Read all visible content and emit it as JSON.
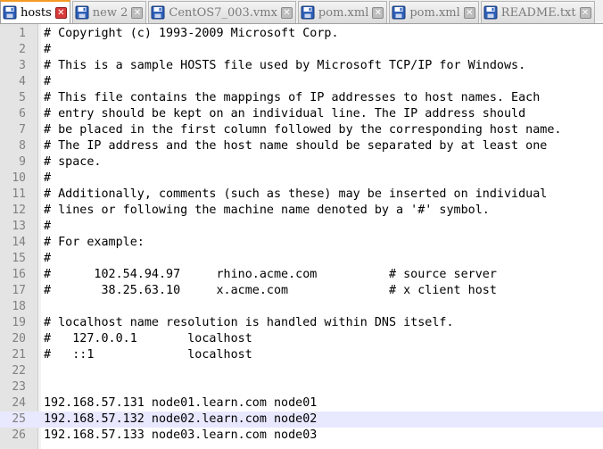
{
  "tabs": [
    {
      "label": "hosts",
      "active": true,
      "icon": "save-icon-blue",
      "close": "✕"
    },
    {
      "label": "new 2",
      "active": false,
      "icon": "save-icon-blue",
      "close": "✕"
    },
    {
      "label": "CentOS7_003.vmx",
      "active": false,
      "icon": "save-icon-blue",
      "close": "✕"
    },
    {
      "label": "pom.xml",
      "active": false,
      "icon": "save-icon-blue",
      "close": "✕"
    },
    {
      "label": "pom.xml",
      "active": false,
      "icon": "save-icon-blue",
      "close": "✕"
    },
    {
      "label": "README.txt",
      "active": false,
      "icon": "save-icon-blue",
      "close": "✕"
    }
  ],
  "colors": {
    "active_tab_accent": "#f59a23",
    "current_line": "#e8e8ff",
    "gutter": "#e4e4e4"
  },
  "current_line": 25,
  "lines": [
    {
      "n": "1",
      "text": "# Copyright (c) 1993-2009 Microsoft Corp."
    },
    {
      "n": "2",
      "text": "#"
    },
    {
      "n": "3",
      "text": "# This is a sample HOSTS file used by Microsoft TCP/IP for Windows."
    },
    {
      "n": "4",
      "text": "#"
    },
    {
      "n": "5",
      "text": "# This file contains the mappings of IP addresses to host names. Each"
    },
    {
      "n": "6",
      "text": "# entry should be kept on an individual line. The IP address should"
    },
    {
      "n": "7",
      "text": "# be placed in the first column followed by the corresponding host name."
    },
    {
      "n": "8",
      "text": "# The IP address and the host name should be separated by at least one"
    },
    {
      "n": "9",
      "text": "# space."
    },
    {
      "n": "10",
      "text": "#"
    },
    {
      "n": "11",
      "text": "# Additionally, comments (such as these) may be inserted on individual"
    },
    {
      "n": "12",
      "text": "# lines or following the machine name denoted by a '#' symbol."
    },
    {
      "n": "13",
      "text": "#"
    },
    {
      "n": "14",
      "text": "# For example:"
    },
    {
      "n": "15",
      "text": "#"
    },
    {
      "n": "16",
      "text": "#      102.54.94.97     rhino.acme.com          # source server"
    },
    {
      "n": "17",
      "text": "#       38.25.63.10     x.acme.com              # x client host"
    },
    {
      "n": "18",
      "text": ""
    },
    {
      "n": "19",
      "text": "# localhost name resolution is handled within DNS itself."
    },
    {
      "n": "20",
      "text": "#   127.0.0.1       localhost"
    },
    {
      "n": "21",
      "text": "#   ::1             localhost"
    },
    {
      "n": "22",
      "text": ""
    },
    {
      "n": "23",
      "text": ""
    },
    {
      "n": "24",
      "text": "192.168.57.131 node01.learn.com node01"
    },
    {
      "n": "25",
      "text": "192.168.57.132 node02.learn.com node02"
    },
    {
      "n": "26",
      "text": "192.168.57.133 node03.learn.com node03"
    }
  ]
}
